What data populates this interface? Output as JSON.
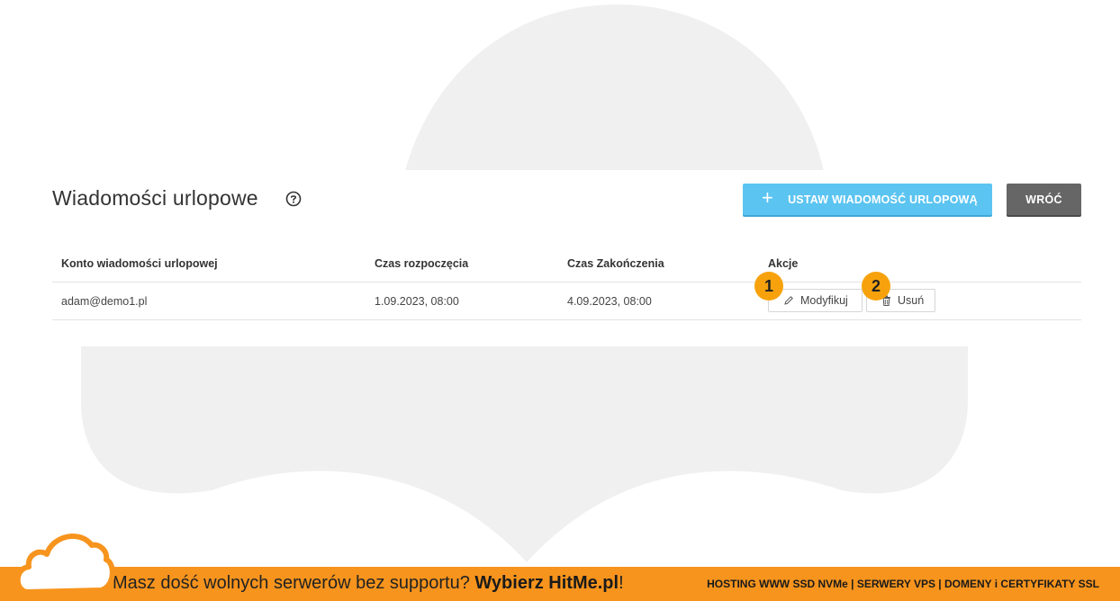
{
  "page": {
    "title": "Wiadomości urlopowe",
    "add_button_label": "USTAW WIADOMOŚĆ URLOPOWĄ",
    "back_button_label": "WRÓĆ"
  },
  "table": {
    "columns": [
      "Konto wiadomości urlopowej",
      "Czas rozpoczęcia",
      "Czas Zakończenia",
      "Akcje"
    ],
    "rows": [
      {
        "account": "adam@demo1.pl",
        "start": "1.09.2023, 08:00",
        "end": "4.09.2023, 08:00"
      }
    ],
    "actions": {
      "edit_label": "Modyfikuj",
      "delete_label": "Usuń"
    }
  },
  "callouts": [
    "1",
    "2"
  ],
  "footer": {
    "text_lead": "Masz dość wolnych serwerów bez supportu? ",
    "text_brand": "Wybierz HitMe.pl",
    "text_end": "!",
    "right_text": "HOSTING WWW SSD NVMe | SERWERY VPS | DOMENY i CERTYFIKATY SSL"
  },
  "colors": {
    "accent_blue": "#5bc4f1",
    "back_gray": "#666666",
    "badge_orange": "#f7a20c",
    "footer_orange": "#f7941d"
  }
}
